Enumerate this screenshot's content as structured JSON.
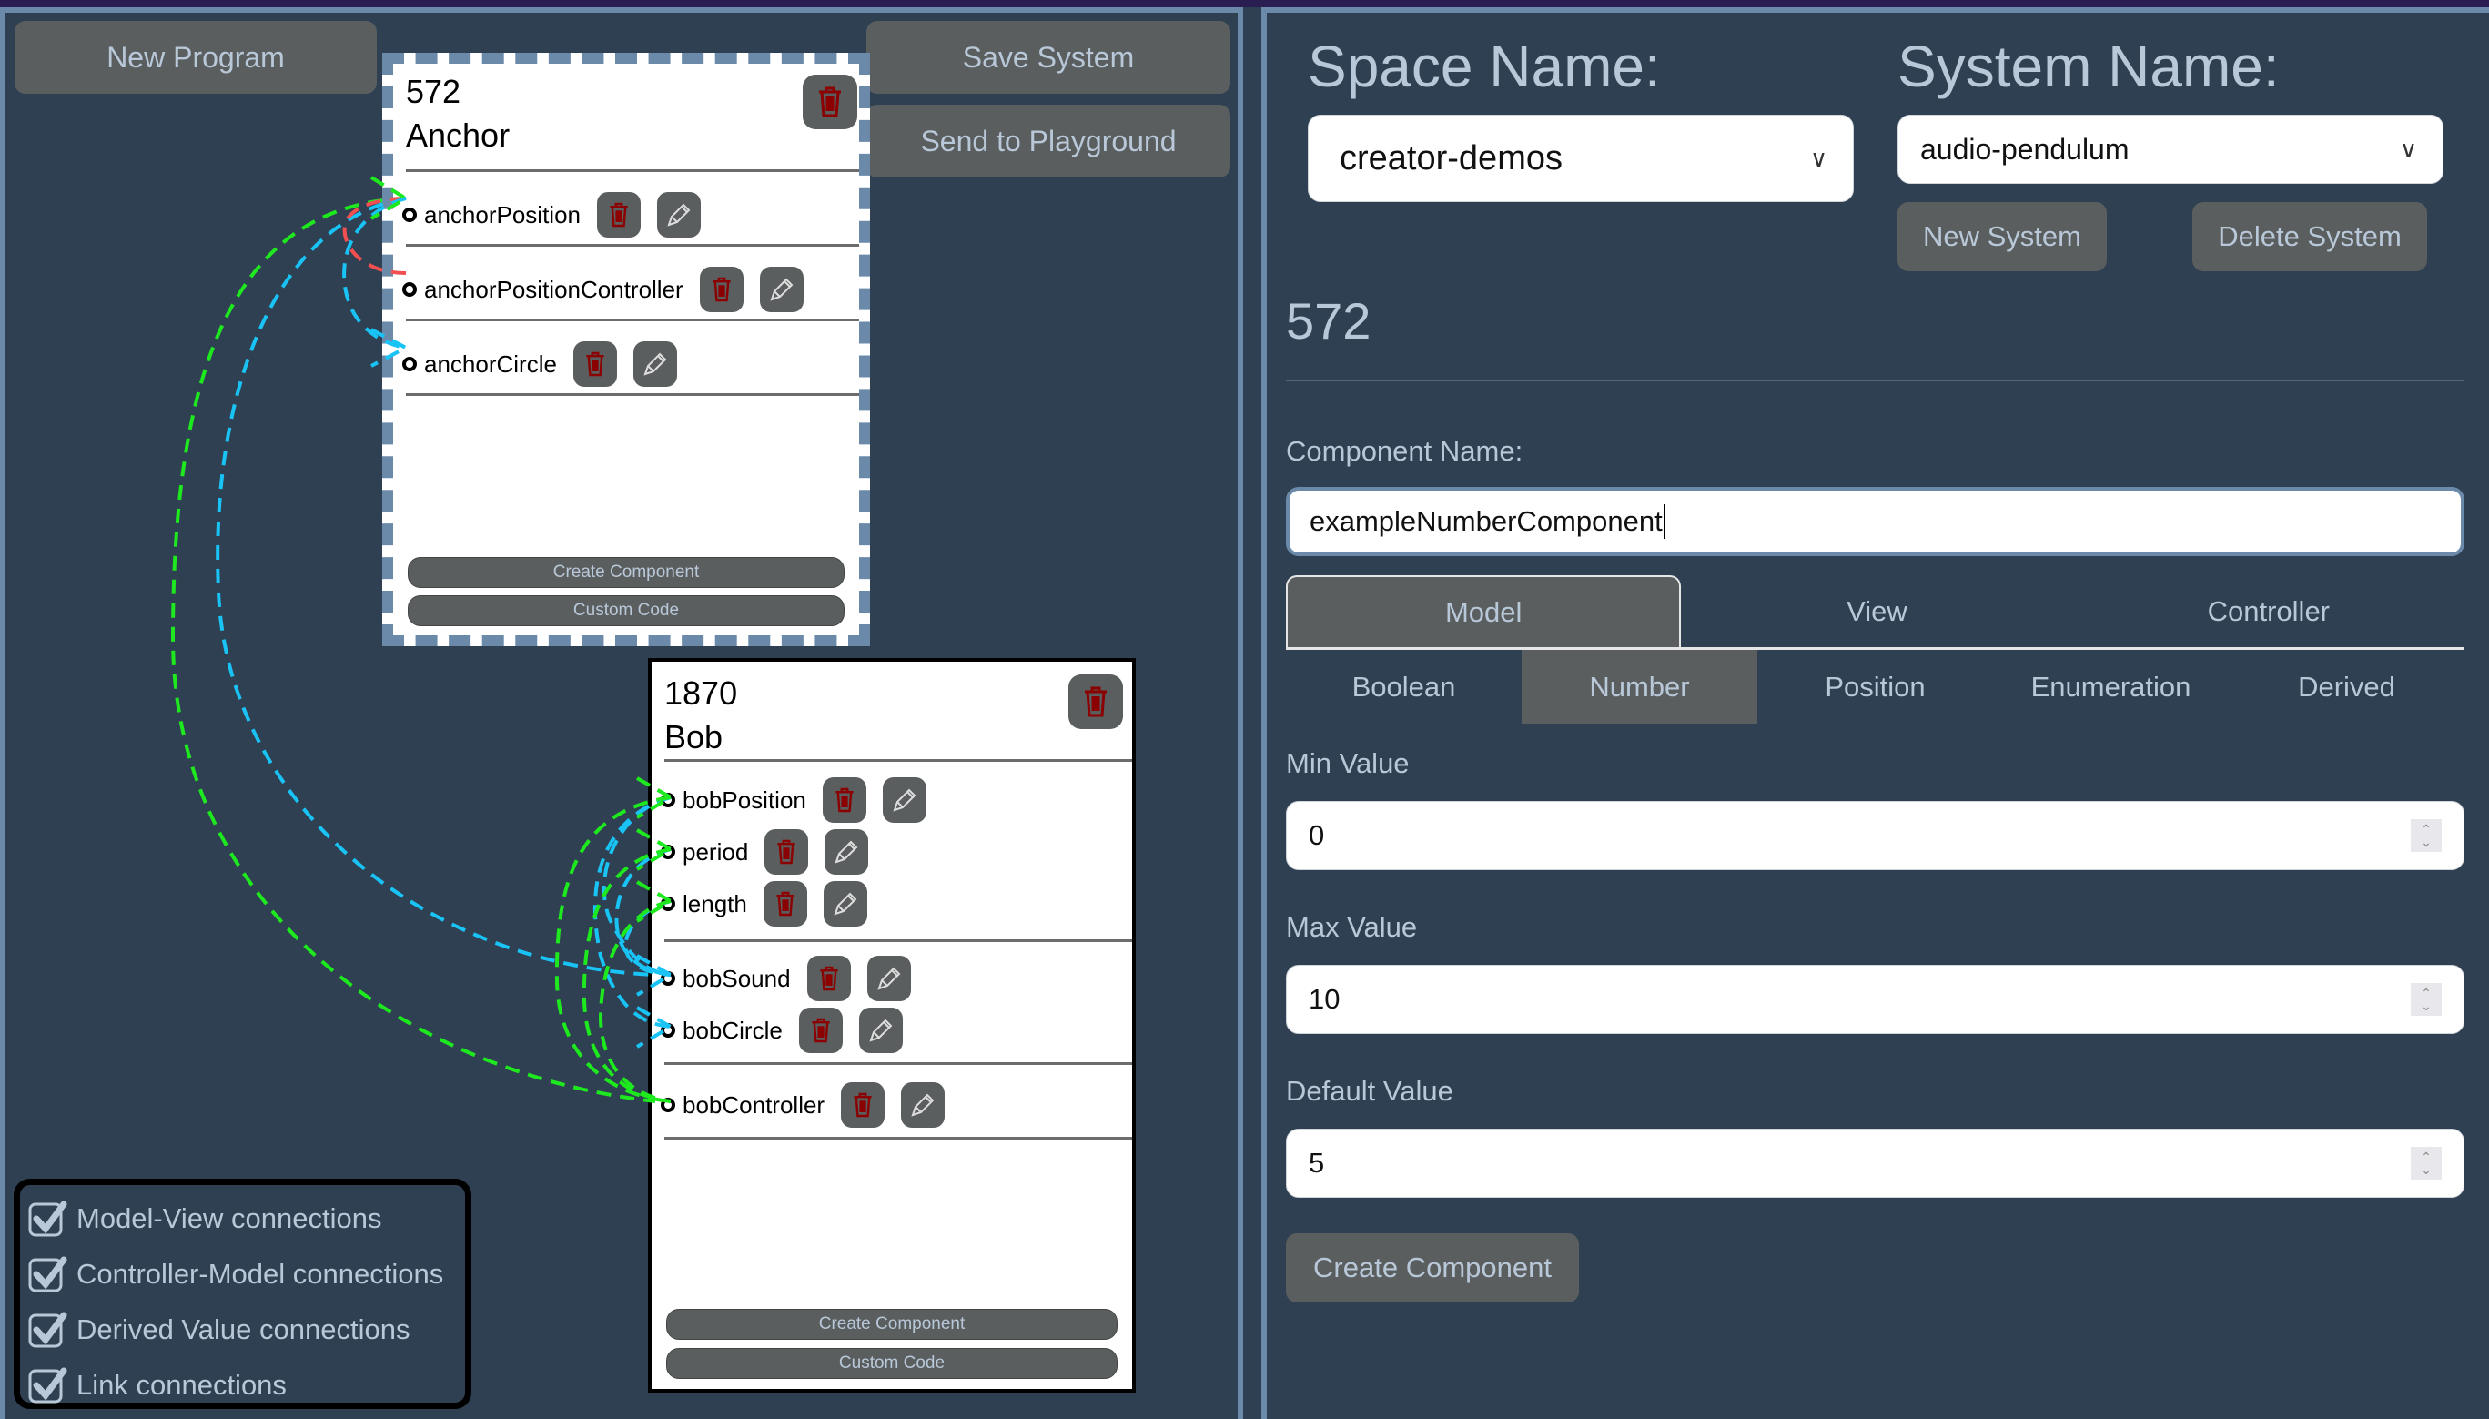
{
  "toolbar": {
    "new_program": "New Program",
    "save_system": "Save System",
    "send_to_playground": "Send to Playground"
  },
  "programs": [
    {
      "id": "572",
      "name": "Anchor",
      "selected": true,
      "components": [
        {
          "label": "anchorPosition",
          "group": "model"
        },
        {
          "label": "anchorPositionController",
          "group": "controller"
        },
        {
          "label": "anchorCircle",
          "group": "view"
        }
      ],
      "create_component": "Create Component",
      "custom_code": "Custom Code"
    },
    {
      "id": "1870",
      "name": "Bob",
      "selected": false,
      "components": [
        {
          "label": "bobPosition",
          "group": "model"
        },
        {
          "label": "period",
          "group": "model"
        },
        {
          "label": "length",
          "group": "model"
        },
        {
          "label": "bobSound",
          "group": "view"
        },
        {
          "label": "bobCircle",
          "group": "view"
        },
        {
          "label": "bobController",
          "group": "controller"
        }
      ],
      "create_component": "Create Component",
      "custom_code": "Custom Code"
    }
  ],
  "connection_toggles": [
    {
      "label": "Model-View connections",
      "checked": true
    },
    {
      "label": "Controller-Model connections",
      "checked": true
    },
    {
      "label": "Derived Value connections",
      "checked": true
    },
    {
      "label": "Link connections",
      "checked": true
    }
  ],
  "connections": [
    {
      "from": "anchorPosition",
      "to": "anchorCircle",
      "type": "model-view",
      "color": "#19c3f5"
    },
    {
      "from": "anchorPositionController",
      "to": "anchorPosition",
      "type": "controller-model",
      "color": "#f25050"
    },
    {
      "from": "anchorPosition",
      "to": "bobController",
      "type": "link",
      "color": "#1ee81e"
    },
    {
      "from": "anchorPosition",
      "to": "bobSound",
      "type": "model-view",
      "color": "#19c3f5"
    },
    {
      "from": "bobPosition",
      "to": "bobSound",
      "type": "model-view",
      "color": "#19c3f5"
    },
    {
      "from": "bobPosition",
      "to": "bobCircle",
      "type": "model-view",
      "color": "#19c3f5"
    },
    {
      "from": "period",
      "to": "bobSound",
      "type": "model-view",
      "color": "#19c3f5"
    },
    {
      "from": "length",
      "to": "bobSound",
      "type": "model-view",
      "color": "#19c3f5"
    },
    {
      "from": "bobPosition",
      "to": "bobController",
      "type": "link",
      "color": "#1ee81e"
    },
    {
      "from": "period",
      "to": "bobController",
      "type": "link",
      "color": "#1ee81e"
    },
    {
      "from": "length",
      "to": "bobController",
      "type": "link",
      "color": "#1ee81e"
    }
  ],
  "editor": {
    "space_label": "Space Name:",
    "space_value": "creator-demos",
    "system_label": "System Name:",
    "system_value": "audio-pendulum",
    "new_system": "New System",
    "delete_system": "Delete System",
    "program_id": "572",
    "component_name_label": "Component Name:",
    "component_name_value": "exampleNumberComponent",
    "tabs": [
      {
        "label": "Model",
        "active": true
      },
      {
        "label": "View",
        "active": false
      },
      {
        "label": "Controller",
        "active": false
      }
    ],
    "subtabs": [
      {
        "label": "Boolean",
        "active": false
      },
      {
        "label": "Number",
        "active": true
      },
      {
        "label": "Position",
        "active": false
      },
      {
        "label": "Enumeration",
        "active": false
      },
      {
        "label": "Derived",
        "active": false
      }
    ],
    "min_label": "Min Value",
    "min_value": "0",
    "max_label": "Max Value",
    "max_value": "10",
    "default_label": "Default Value",
    "default_value": "5",
    "create_component": "Create Component"
  },
  "colors": {
    "background": "#2e4052",
    "panel_border": "#6b8aaa",
    "button": "#5a5e5f",
    "button_text": "#b9c8d8",
    "model_view": "#19c3f5",
    "controller_model": "#f25050",
    "link": "#1ee81e",
    "trash": "#8b0000"
  }
}
